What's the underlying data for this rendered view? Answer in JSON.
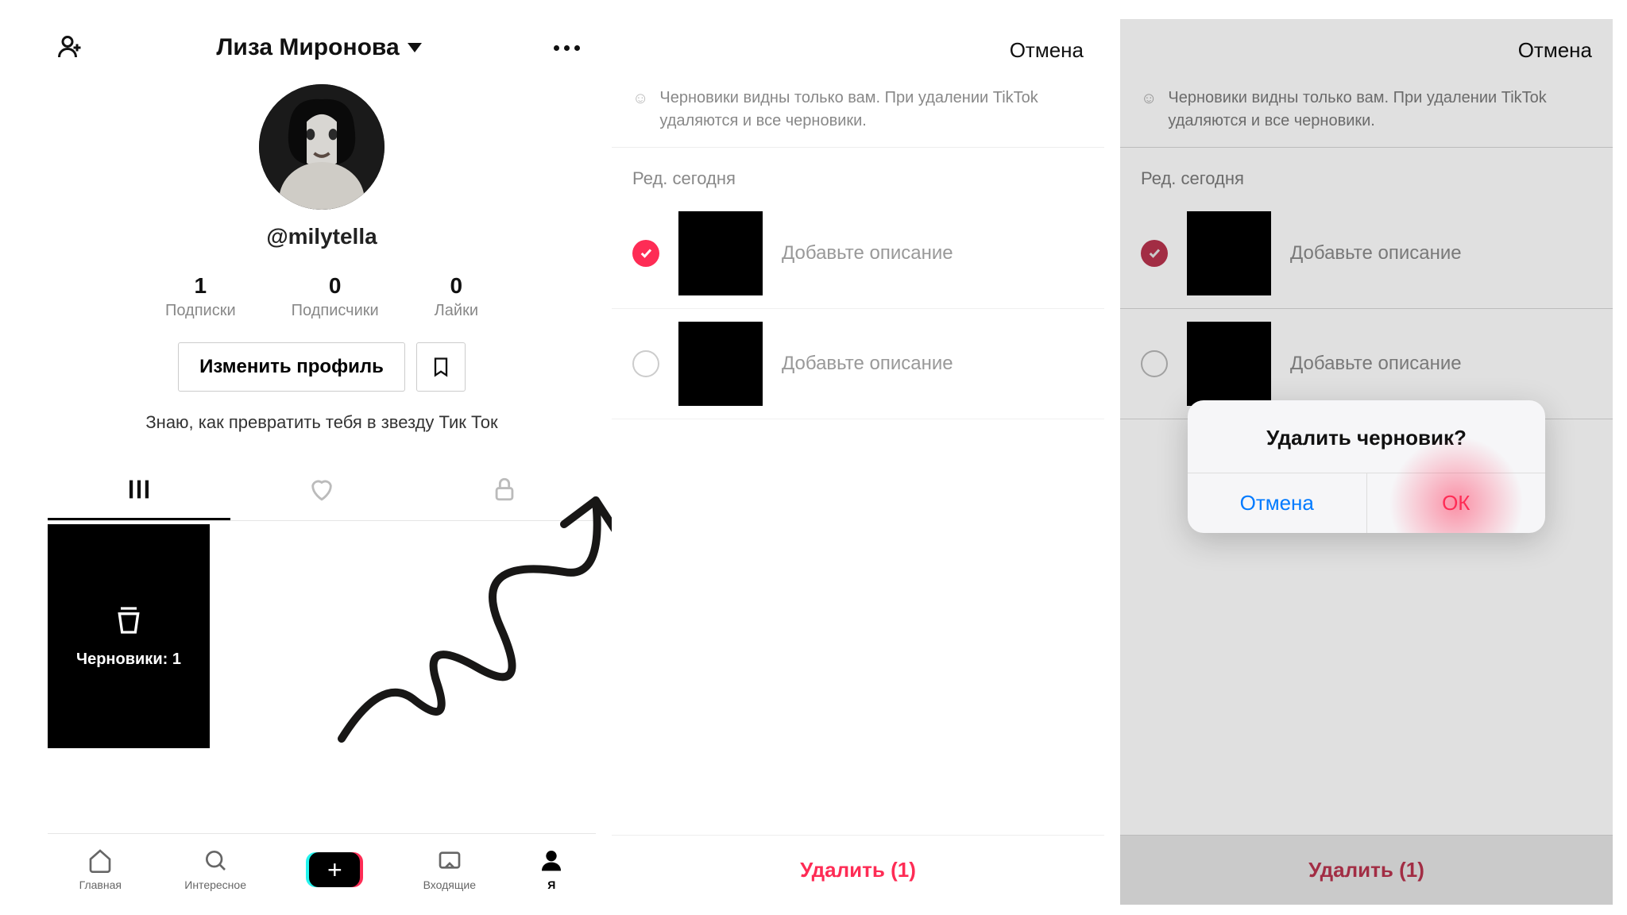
{
  "pane1": {
    "header_title": "Лиза Миронова",
    "handle": "@milytella",
    "stats": [
      {
        "num": "1",
        "label": "Подписки"
      },
      {
        "num": "0",
        "label": "Подписчики"
      },
      {
        "num": "0",
        "label": "Лайки"
      }
    ],
    "edit_button": "Изменить профиль",
    "bio": "Знаю, как превратить тебя в звезду Тик Ток",
    "draft_tile_label": "Черновики: 1",
    "nav": [
      {
        "label": "Главная"
      },
      {
        "label": "Интересное"
      },
      {
        "label": ""
      },
      {
        "label": "Входящие"
      },
      {
        "label": "Я"
      }
    ]
  },
  "pane2": {
    "cancel": "Отмена",
    "info_text": "Черновики видны только вам. При удалении TikTok удаляются и все черновики.",
    "section": "Ред. сегодня",
    "drafts": [
      {
        "desc": "Добавьте описание",
        "selected": true
      },
      {
        "desc": "Добавьте описание",
        "selected": false
      }
    ],
    "delete_btn": "Удалить (1)"
  },
  "pane3": {
    "cancel": "Отмена",
    "info_text": "Черновики видны только вам. При удалении TikTok удаляются и все черновики.",
    "section": "Ред. сегодня",
    "drafts": [
      {
        "desc": "Добавьте описание",
        "selected": true
      },
      {
        "desc": "Добавьте описание",
        "selected": false
      }
    ],
    "delete_btn": "Удалить (1)",
    "dialog": {
      "title": "Удалить черновик?",
      "cancel": "Отмена",
      "ok": "ОК"
    }
  }
}
